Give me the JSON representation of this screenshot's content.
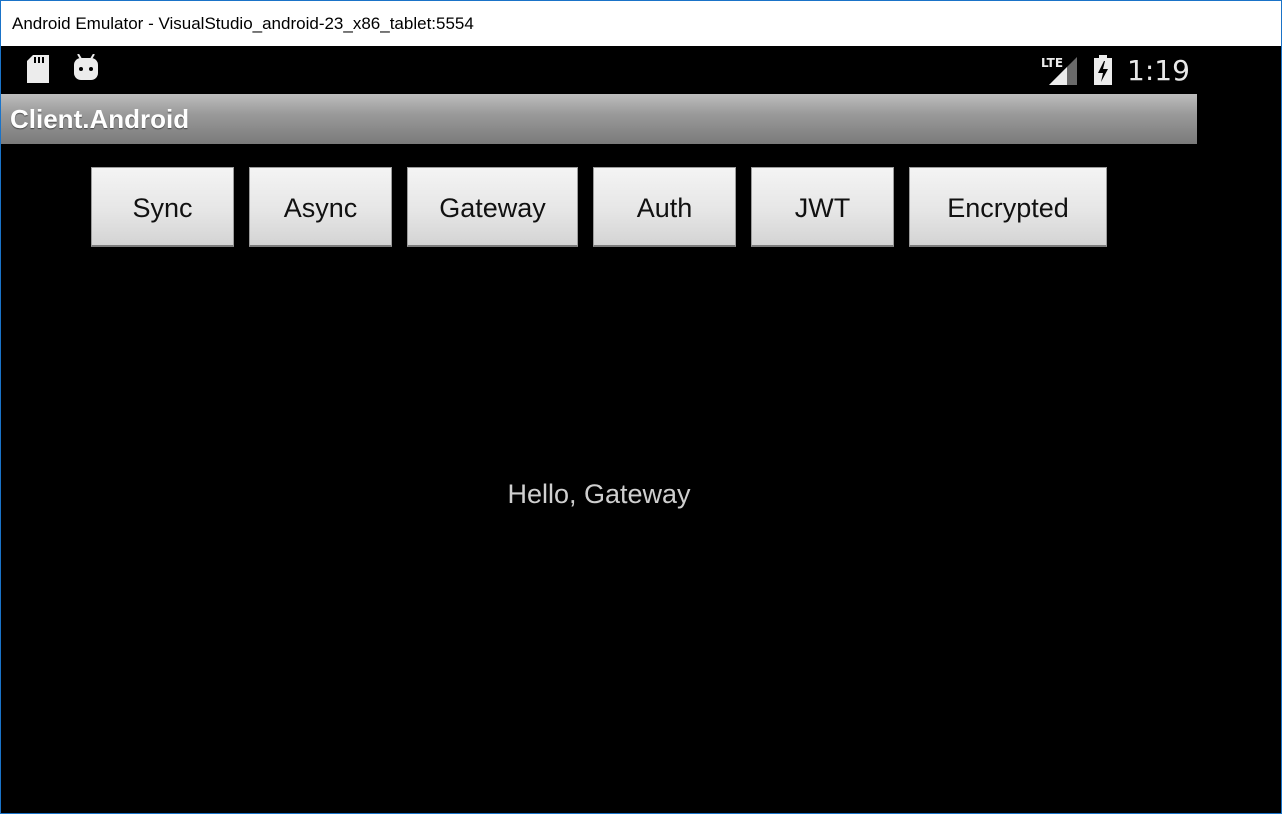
{
  "window": {
    "title": "Android Emulator - VisualStudio_android-23_x86_tablet:5554"
  },
  "statusbar": {
    "icons_left": [
      "sd-card-icon",
      "android-debug-icon"
    ],
    "icons_right": [
      "lte-signal-icon",
      "battery-charging-icon"
    ],
    "network_label": "LTE",
    "time": "1:19"
  },
  "actionbar": {
    "title": "Client.Android"
  },
  "buttons": {
    "sync": "Sync",
    "async": "Async",
    "gateway": "Gateway",
    "auth": "Auth",
    "jwt": "JWT",
    "encrypted": "Encrypted"
  },
  "content": {
    "message": "Hello, Gateway"
  },
  "colors": {
    "background": "#000000",
    "button_face": "#e6e6e6",
    "actionbar": "#9a9a9a",
    "message_text": "#cfcfcf"
  }
}
